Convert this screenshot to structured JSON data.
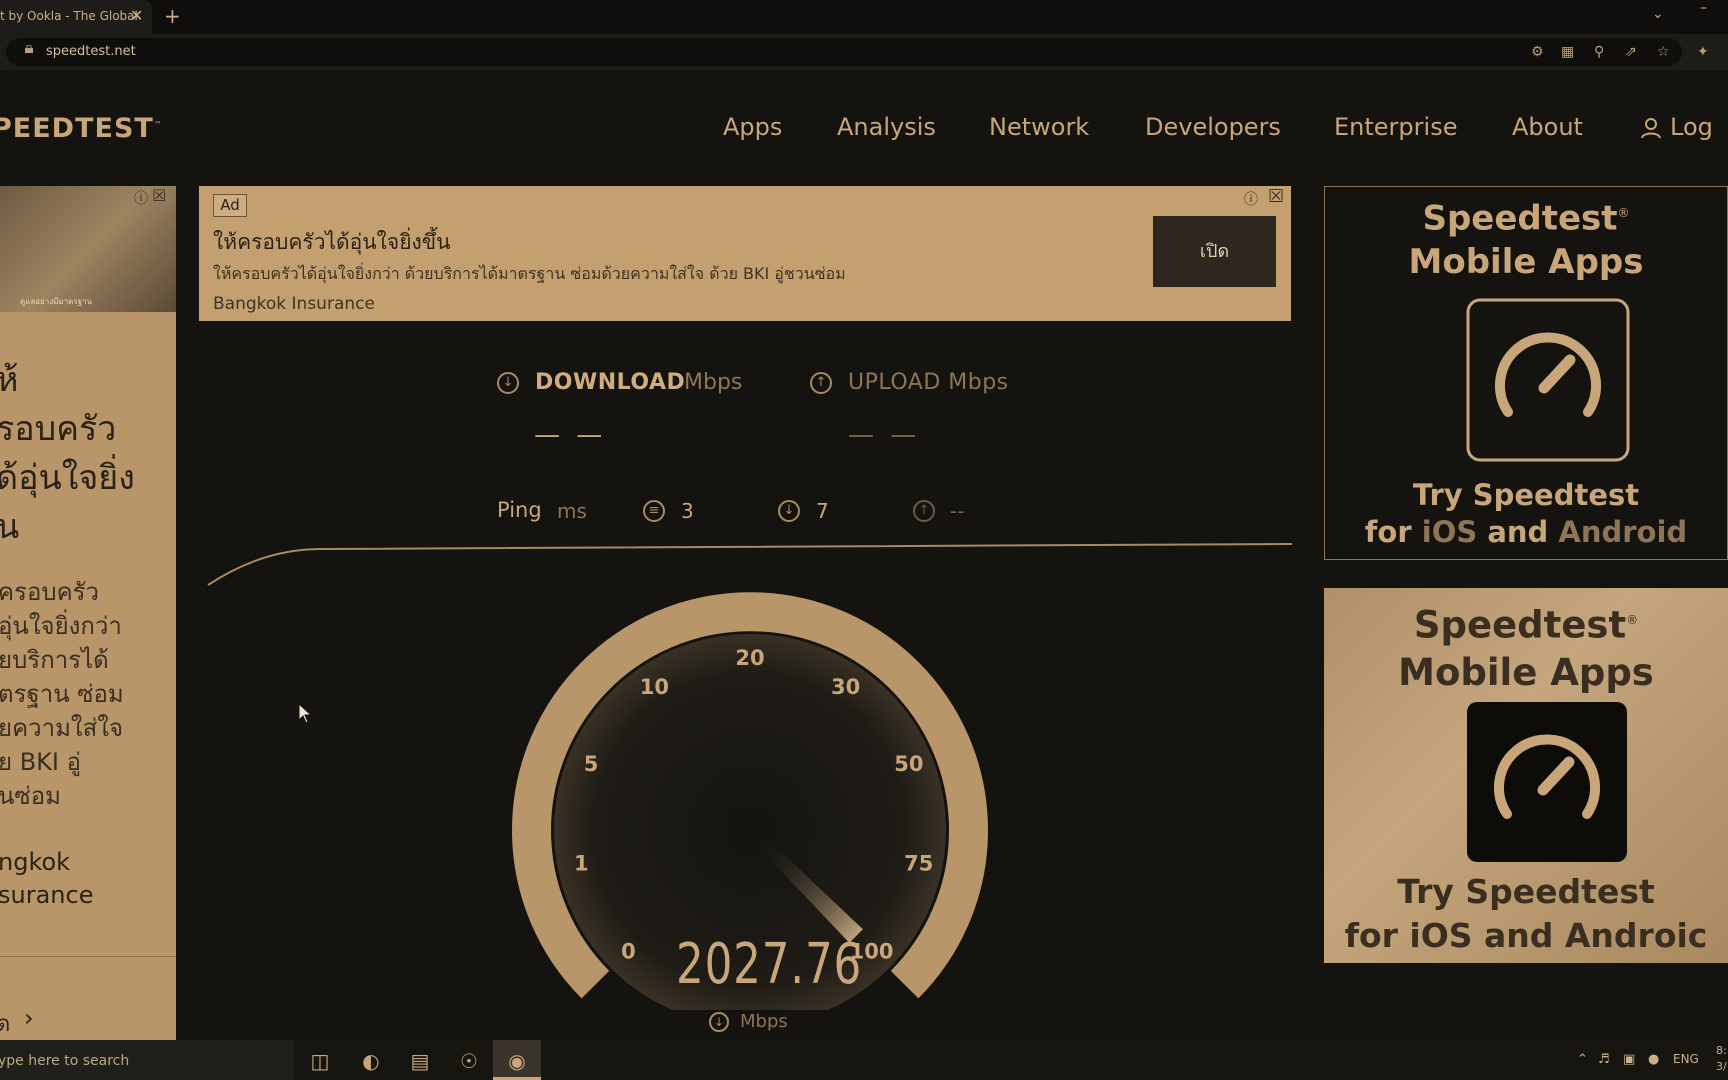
{
  "browser": {
    "tab_title": "t by Ookla - The Global",
    "tab_close": "✕",
    "new_tab": "+",
    "url": "speedtest.net"
  },
  "header": {
    "logo": "PEEDTEST",
    "nav": {
      "apps": "Apps",
      "analysis": "Analysis",
      "network": "Network",
      "developers": "Developers",
      "enterprise": "Enterprise",
      "about": "About",
      "login": "Log"
    }
  },
  "left_ad": {
    "image_caption": "ดูแลอย่างมีมาตรฐาน",
    "title_lines": [
      "ห้",
      "รอบครัว",
      "ด้อุ่นใจยิ่ง",
      "น"
    ],
    "body_lines": [
      "ครอบครัว",
      "อุ่นใจยิ่งกว่า",
      "ยบริการได้",
      "ตรฐาน ซ่อม",
      "ยความใส่ใจ",
      "ย BKI อู่",
      "นซ่อม"
    ],
    "brand_lines": [
      "ngkok",
      "surance"
    ],
    "link": "ด"
  },
  "top_ad": {
    "tag": "Ad",
    "title": "ให้ครอบครัวได้อุ่นใจยิ่งขึ้น",
    "body": "ให้ครอบครัวได้อุ่นใจยิ่งกว่า ด้วยบริการได้มาตรฐาน ซ่อมด้วยความใส่ใจ ด้วย BKI อู่ชวนซ่อม",
    "brand": "Bangkok Insurance",
    "button": "เปิด"
  },
  "speedtest": {
    "download_label": "DOWNLOAD",
    "download_unit": "Mbps",
    "upload_label": "UPLOAD Mbps",
    "download_value": "— —",
    "upload_value": "— —",
    "ping_label": "Ping",
    "ping_unit": "ms",
    "ping_idle": "3",
    "ping_download": "7",
    "ping_upload": "--",
    "gauge_labels": [
      "0",
      "1",
      "5",
      "10",
      "20",
      "30",
      "50",
      "75",
      "100"
    ],
    "gauge_needle_value": 100,
    "current_value": "2027.76",
    "current_unit": "Mbps"
  },
  "right_ad_1": {
    "title_lines": [
      "Speedtest",
      "Mobile Apps"
    ],
    "reg": "®",
    "sub_line1": "Try Speedtest",
    "sub_for": "for ",
    "sub_ios": "iOS",
    "sub_and": " and ",
    "sub_android": "Android"
  },
  "right_ad_2": {
    "title_lines": [
      "Speedtest",
      "Mobile Apps"
    ],
    "reg": "®",
    "sub_line1": "Try Speedtest",
    "sub_line2": "for iOS and Androic"
  },
  "taskbar": {
    "search_placeholder": "ype here to search",
    "lang": "ENG",
    "time": "8:",
    "date": "3/"
  }
}
